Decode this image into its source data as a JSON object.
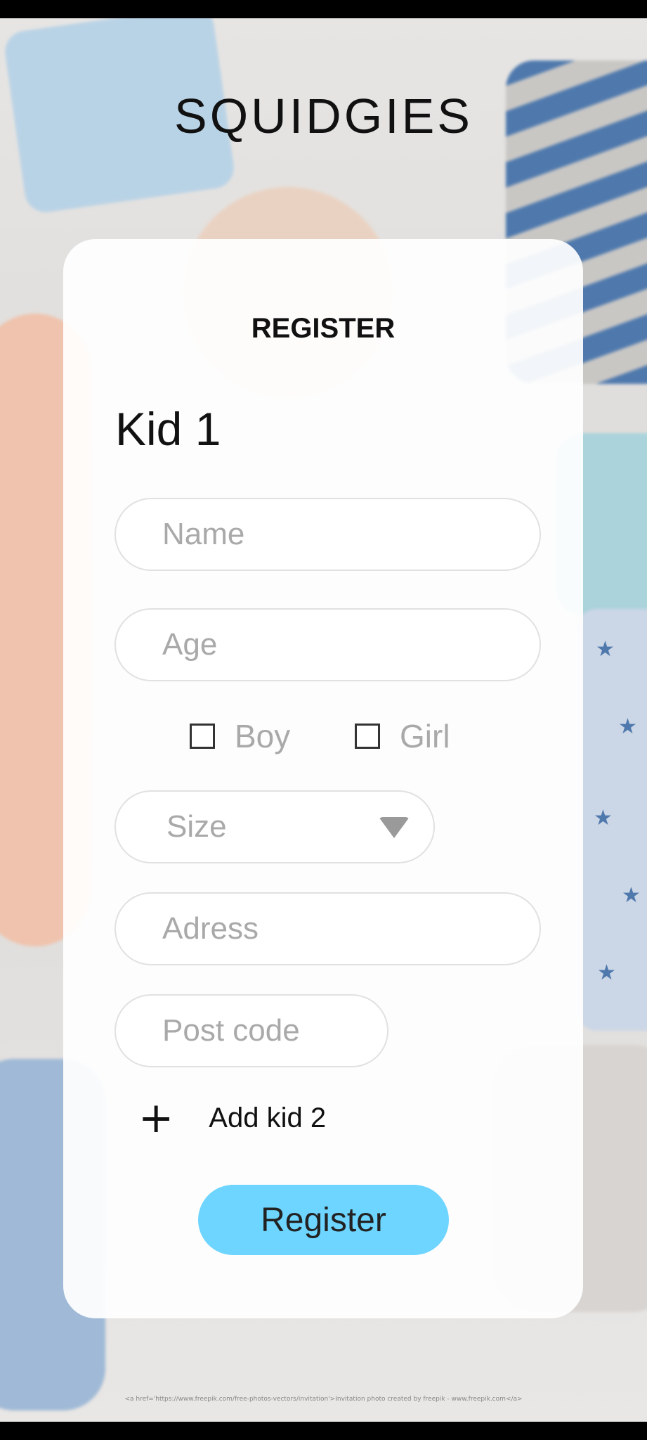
{
  "app": {
    "logo_text": "SQUIDGIES"
  },
  "form": {
    "title": "REGISTER",
    "kid_heading": "Kid 1",
    "name_placeholder": "Name",
    "age_placeholder": "Age",
    "gender": {
      "boy_label": "Boy",
      "girl_label": "Girl",
      "boy_checked": false,
      "girl_checked": false
    },
    "size_label": "Size",
    "address_placeholder": "Adress",
    "postcode_placeholder": "Post code",
    "add_kid_label": "Add kid 2",
    "submit_label": "Register"
  },
  "footer": {
    "credit": "<a href='https://www.freepik.com/free-photos-vectors/invitation'>Invitation photo created by freepik - www.freepik.com</a>"
  },
  "icons": {
    "add": "plus-icon",
    "size_dropdown": "chevron-down-icon"
  },
  "colors": {
    "accent": "#6dd5ff",
    "placeholder": "#a9a9a9",
    "text": "#111111"
  }
}
